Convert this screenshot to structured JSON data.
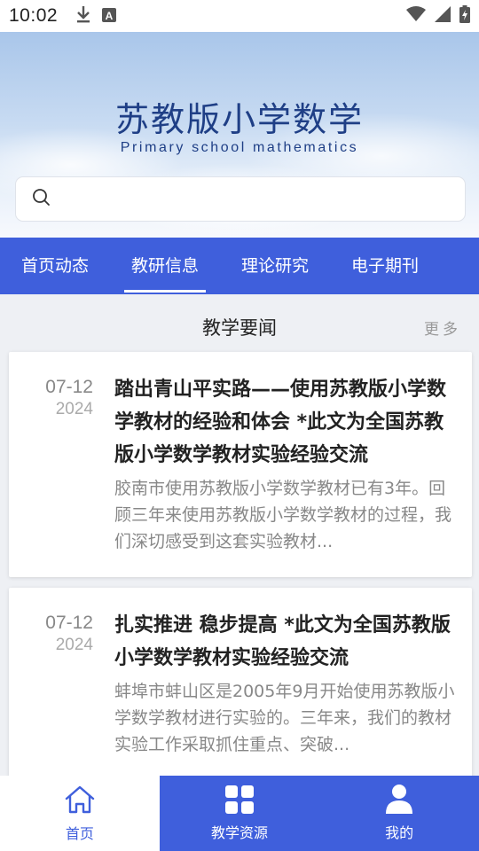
{
  "status_bar": {
    "time": "10:02",
    "icons": [
      "download-icon",
      "keyboard-a-icon",
      "wifi-icon",
      "signal-icon",
      "battery-icon"
    ]
  },
  "hero": {
    "title": "苏教版小学数学",
    "subtitle": "Primary school mathematics"
  },
  "search": {
    "placeholder": "",
    "value": ""
  },
  "tabs": [
    {
      "label": "首页动态",
      "active": false
    },
    {
      "label": "教研信息",
      "active": true
    },
    {
      "label": "理论研究",
      "active": false
    },
    {
      "label": "电子期刊",
      "active": false
    }
  ],
  "section": {
    "title": "教学要闻",
    "more": "更多"
  },
  "news": [
    {
      "date": "07-12",
      "year": "2024",
      "title": "踏出青山平实路——使用苏教版小学数学教材的经验和体会 *此文为全国苏教版小学数学教材实验经验交流",
      "summary": "胶南市使用苏教版小学数学教材已有3年。回顾三年来使用苏教版小学数学教材的过程，我们深切感受到这套实验教材..."
    },
    {
      "date": "07-12",
      "year": "2024",
      "title": "扎实推进 稳步提高 *此文为全国苏教版小学数学教材实验经验交流",
      "summary": "蚌埠市蚌山区是2005年9月开始使用苏教版小学数学教材进行实验的。三年来，我们的教材实验工作采取抓住重点、突破..."
    }
  ],
  "bottom_nav": [
    {
      "label": "首页",
      "icon": "home-icon",
      "active": true
    },
    {
      "label": "教学资源",
      "icon": "grid-icon",
      "active": false
    },
    {
      "label": "我的",
      "icon": "user-icon",
      "active": false
    }
  ],
  "colors": {
    "accent": "#3f5fdc",
    "title": "#1f3f86"
  }
}
